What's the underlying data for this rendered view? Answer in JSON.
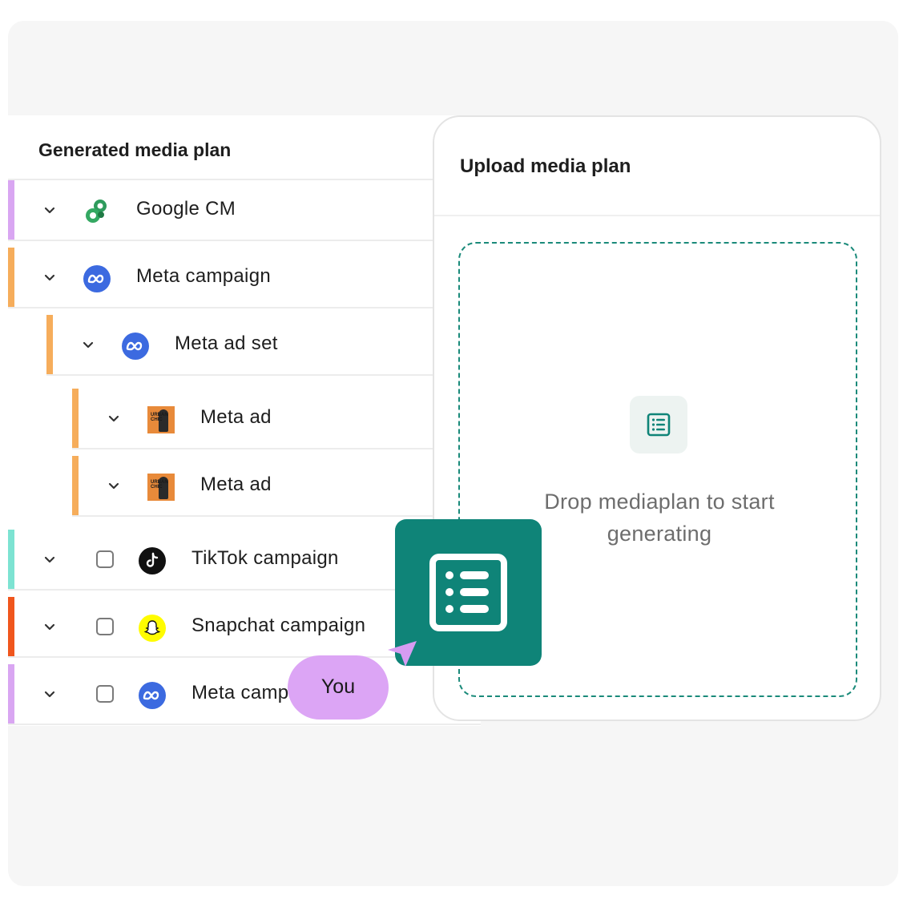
{
  "plan": {
    "title": "Generated media plan",
    "rows": [
      {
        "label": "Google CM",
        "logo": "google-cm-icon",
        "bar_color": "#d9a6f2"
      },
      {
        "label": "Meta campaign",
        "logo": "meta-icon",
        "bar_color": "#f6ad5b"
      },
      {
        "label": "Meta ad set",
        "logo": "meta-icon",
        "bar_color": "#f6ad5b"
      },
      {
        "label": "Meta ad",
        "logo": "ad-thumbnail",
        "bar_color": "#f6ad5b",
        "thumb_text": "URBAN CHIC"
      },
      {
        "label": "Meta ad",
        "logo": "ad-thumbnail",
        "bar_color": "#f6ad5b",
        "thumb_text": "URBAN CHIC"
      },
      {
        "label": "TikTok campaign",
        "logo": "tiktok-icon",
        "bar_color": "#7de3d2"
      },
      {
        "label": "Snapchat campaign",
        "logo": "snapchat-icon",
        "bar_color": "#f0561d"
      },
      {
        "label": "Meta campaign",
        "logo": "meta-icon",
        "bar_color": "#d9a6f2"
      }
    ]
  },
  "upload": {
    "title": "Upload media plan",
    "drop_text": "Drop mediaplan to start generating"
  },
  "cursor": {
    "label": "You"
  },
  "colors": {
    "accent": "#0f8478",
    "meta": "#3c6ae0",
    "you_bubble": "#dca5f5"
  }
}
